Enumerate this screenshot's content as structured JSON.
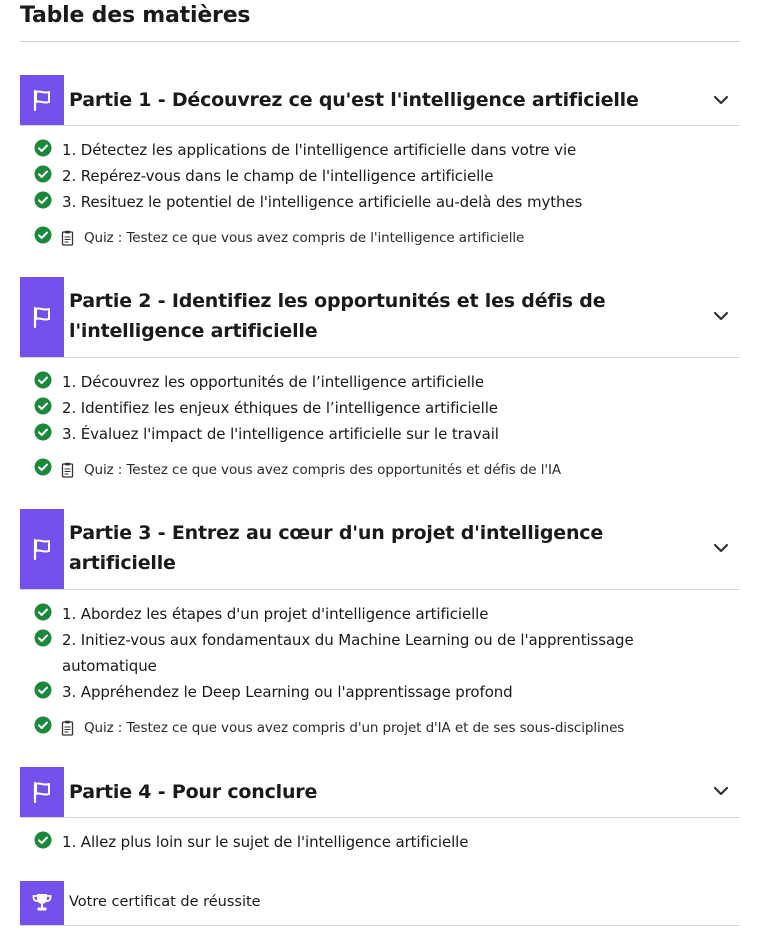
{
  "toc": {
    "title": "Table des matières"
  },
  "parts": [
    {
      "title": "Partie 1 - Découvrez ce qu'est l'intelligence artificielle",
      "chapters": [
        "1. Détectez les applications de l'intelligence artificielle dans votre vie",
        "2. Repérez-vous dans le champ de l'intelligence artificielle",
        "3. Resituez le potentiel de l'intelligence artificielle au-delà des mythes"
      ],
      "quiz": "Quiz : Testez ce que vous avez compris de l'intelligence artificielle"
    },
    {
      "title_line1": "Partie 2 - Identifiez les opportunités et les défis de",
      "title_line2": "l'intelligence artificielle",
      "chapters": [
        "1. Découvrez les opportunités de l’intelligence artificielle",
        "2. Identifiez les enjeux éthiques de l’intelligence artificielle",
        "3. Évaluez l'impact de l'intelligence artificielle sur le travail"
      ],
      "quiz": "Quiz : Testez ce que vous avez compris des opportunités et défis de l'IA"
    },
    {
      "title_line1": "Partie 3 - Entrez au cœur d'un projet d'intelligence",
      "title_line2": "artificielle",
      "chapters": [
        "1. Abordez les étapes d'un projet d'intelligence artificielle",
        "2. Initiez-vous aux fondamentaux du Machine Learning ou de l'apprentissage",
        "automatique",
        "3. Appréhendez le Deep Learning ou l'apprentissage profond"
      ],
      "quiz": "Quiz : Testez ce que vous avez compris d'un projet d'IA et de ses sous-disciplines"
    },
    {
      "title": "Partie 4 - Pour conclure",
      "chapters": [
        "1. Allez plus loin sur le sujet de l'intelligence artificielle"
      ]
    }
  ],
  "certificate": {
    "label": "Votre certificat de réussite"
  },
  "colors": {
    "accent": "#7451eb",
    "check": "#1a8a3a"
  },
  "icons": {
    "part": "flag-icon",
    "toggle": "chevron-down-icon",
    "done": "check-circle-icon",
    "quiz": "quiz-icon",
    "certificate": "trophy-icon"
  }
}
